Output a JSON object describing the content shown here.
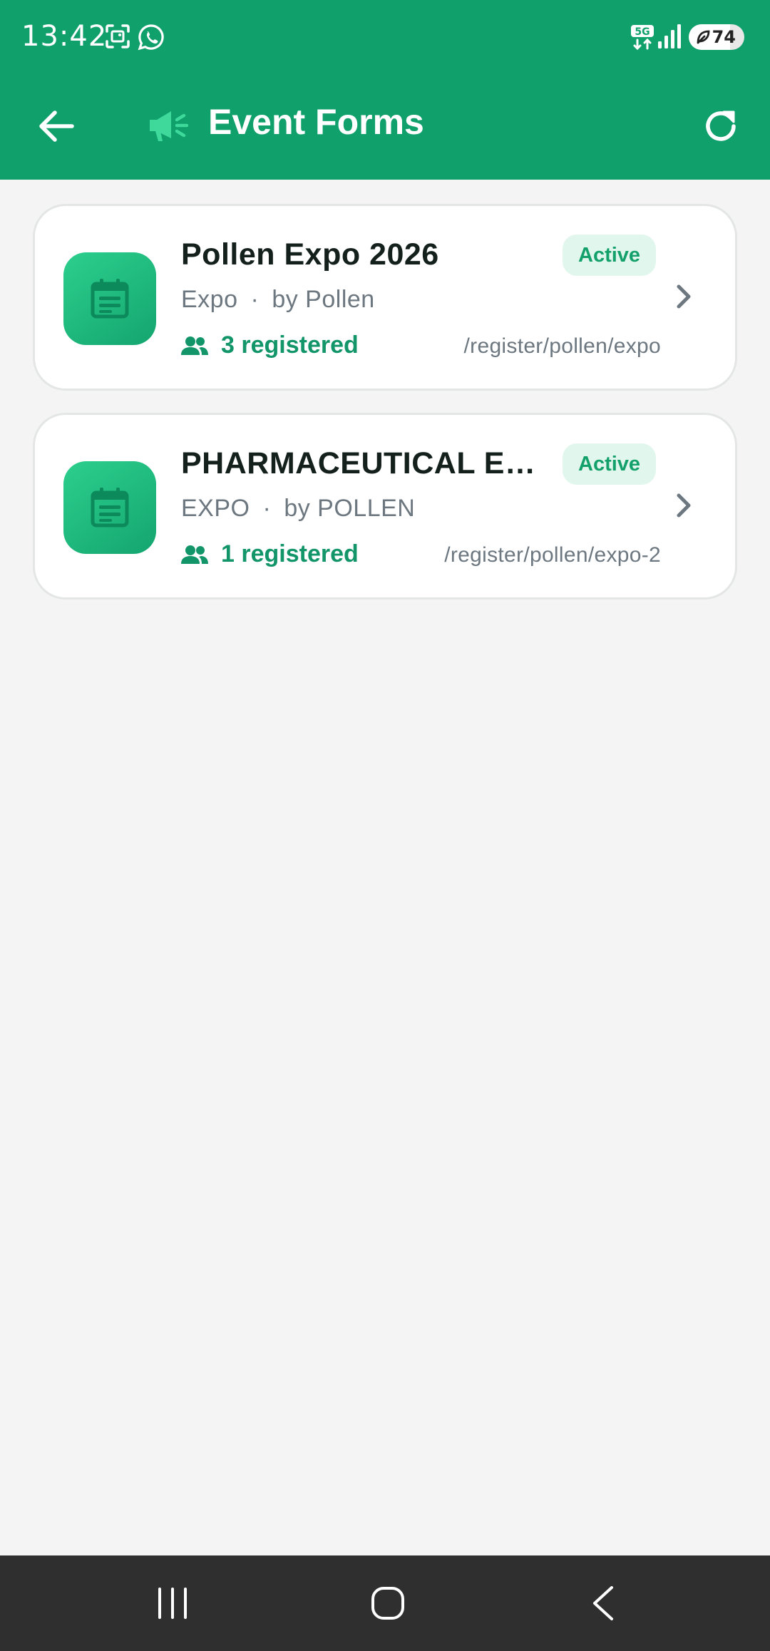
{
  "status_bar": {
    "time": "13:42",
    "network": "5G",
    "battery_percent": "74",
    "battery_level": 0.74,
    "icons": [
      "screenshot-icon",
      "whatsapp-icon",
      "5g-icon",
      "signal-icon",
      "battery-icon"
    ]
  },
  "header": {
    "title": "Event Forms",
    "icons": [
      "back-arrow-icon",
      "megaphone-icon",
      "refresh-icon"
    ]
  },
  "events": [
    {
      "title": "Pollen Expo 2026",
      "status": "Active",
      "type": "Expo",
      "separator": "·",
      "organizer": "by Pollen",
      "registered": "3 registered",
      "url": "/register/pollen/expo"
    },
    {
      "title": "PHARMACEUTICAL EXPO",
      "status": "Active",
      "type": "EXPO",
      "separator": "·",
      "organizer": "by POLLEN",
      "registered": "1 registered",
      "url": "/register/pollen/expo-2"
    }
  ],
  "colors": {
    "primary": "#0fa06b",
    "background": "#f3f4f3",
    "badge_bg": "#e1f6ec",
    "badge_text": "#13a06b",
    "title_text": "#14201b",
    "muted_text": "#6c7780",
    "nav_bar": "#2f2f2f"
  },
  "nav_bar": {
    "icons": [
      "recent-apps-icon",
      "home-icon",
      "nav-back-icon"
    ]
  }
}
